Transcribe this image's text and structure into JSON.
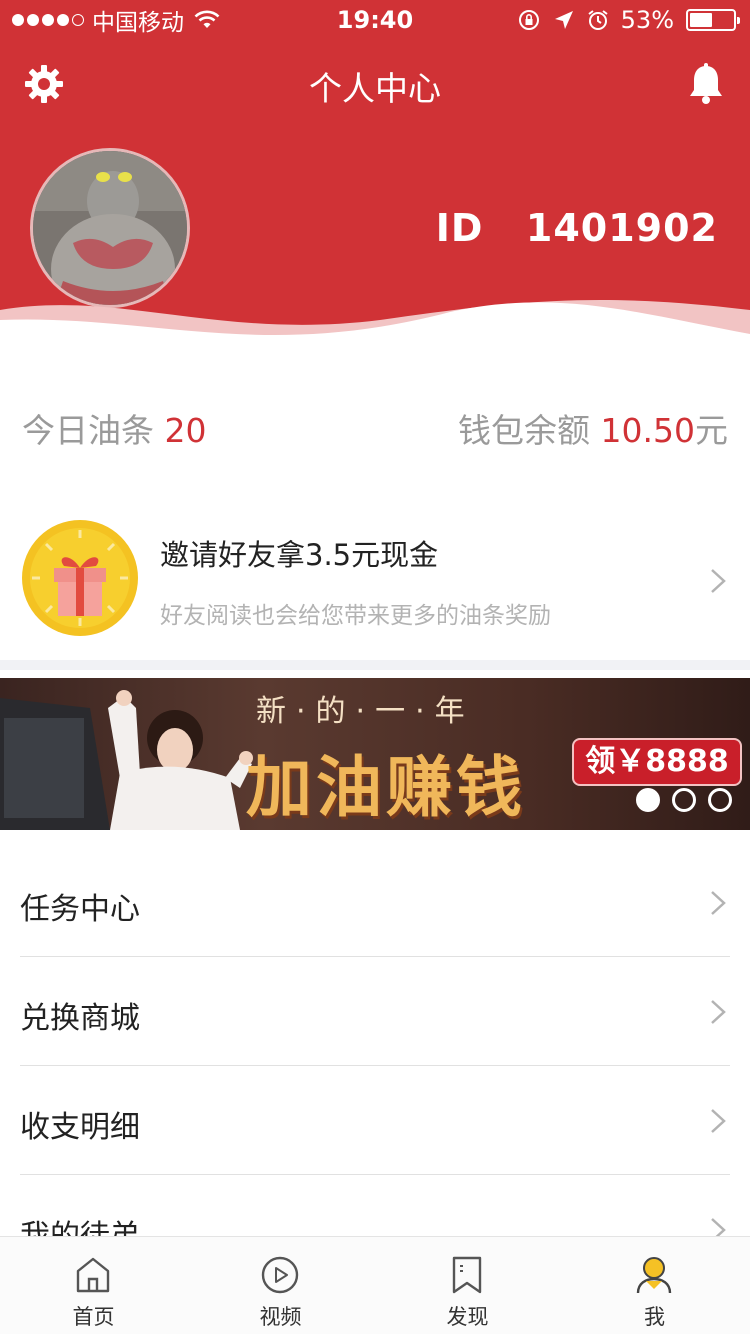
{
  "status_bar": {
    "carrier": "中国移动",
    "time": "19:40",
    "battery": "53%",
    "battery_level": 0.53,
    "icons": [
      "signal-dots-icon",
      "wifi-icon",
      "rotation-lock-icon",
      "location-icon",
      "alarm-icon",
      "battery-icon"
    ]
  },
  "header": {
    "title": "个人中心",
    "id_label": "ID",
    "id_value": "1401902",
    "background_color": "#d03236",
    "icons": [
      "gear-icon",
      "bell-icon"
    ]
  },
  "stats": {
    "oil_label": "今日油条",
    "oil_value": "20",
    "wallet_label": "钱包余额",
    "wallet_value": "10.50",
    "wallet_unit": "元"
  },
  "invite": {
    "title": "邀请好友拿3.5元现金",
    "subtitle": "好友阅读也会给您带来更多的油条奖励",
    "icon": "gift-icon"
  },
  "banner": {
    "top_text": "新·的·一·年",
    "main_text": "加油赚钱",
    "badge": "领￥8888",
    "slides": 3,
    "active_slide": 1
  },
  "menu": [
    {
      "label": "任务中心"
    },
    {
      "label": "兑换商城"
    },
    {
      "label": "收支明细"
    },
    {
      "label": "我的徒弟"
    }
  ],
  "tabbar": [
    {
      "label": "首页",
      "icon": "home-icon"
    },
    {
      "label": "视频",
      "icon": "play-icon"
    },
    {
      "label": "发现",
      "icon": "bookmark-icon"
    },
    {
      "label": "我",
      "icon": "user-icon",
      "active": true
    }
  ],
  "colors": {
    "accent": "#d03236",
    "tab_active": "#f5c125"
  }
}
